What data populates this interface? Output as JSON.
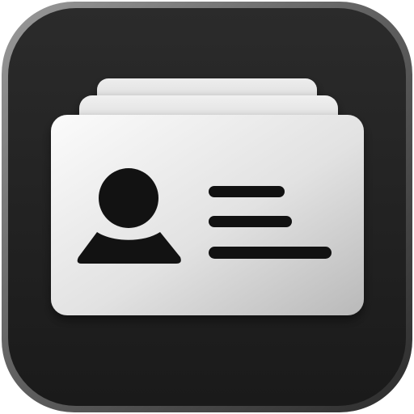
{
  "app_icon": {
    "icon_name": "contact-cards-icon",
    "colors": {
      "background_dark": "#1f1f1f",
      "background_mid": "#2b2b2b",
      "border_light": "#8a8a8a",
      "card_light": "#f7f7f7",
      "card_mid": "#dedede",
      "card_dark": "#b8b8b8",
      "glyph": "#111111"
    },
    "parts": {
      "avatar": "person-icon",
      "details": "text-lines-icon",
      "stack": "stacked-cards-icon"
    }
  }
}
